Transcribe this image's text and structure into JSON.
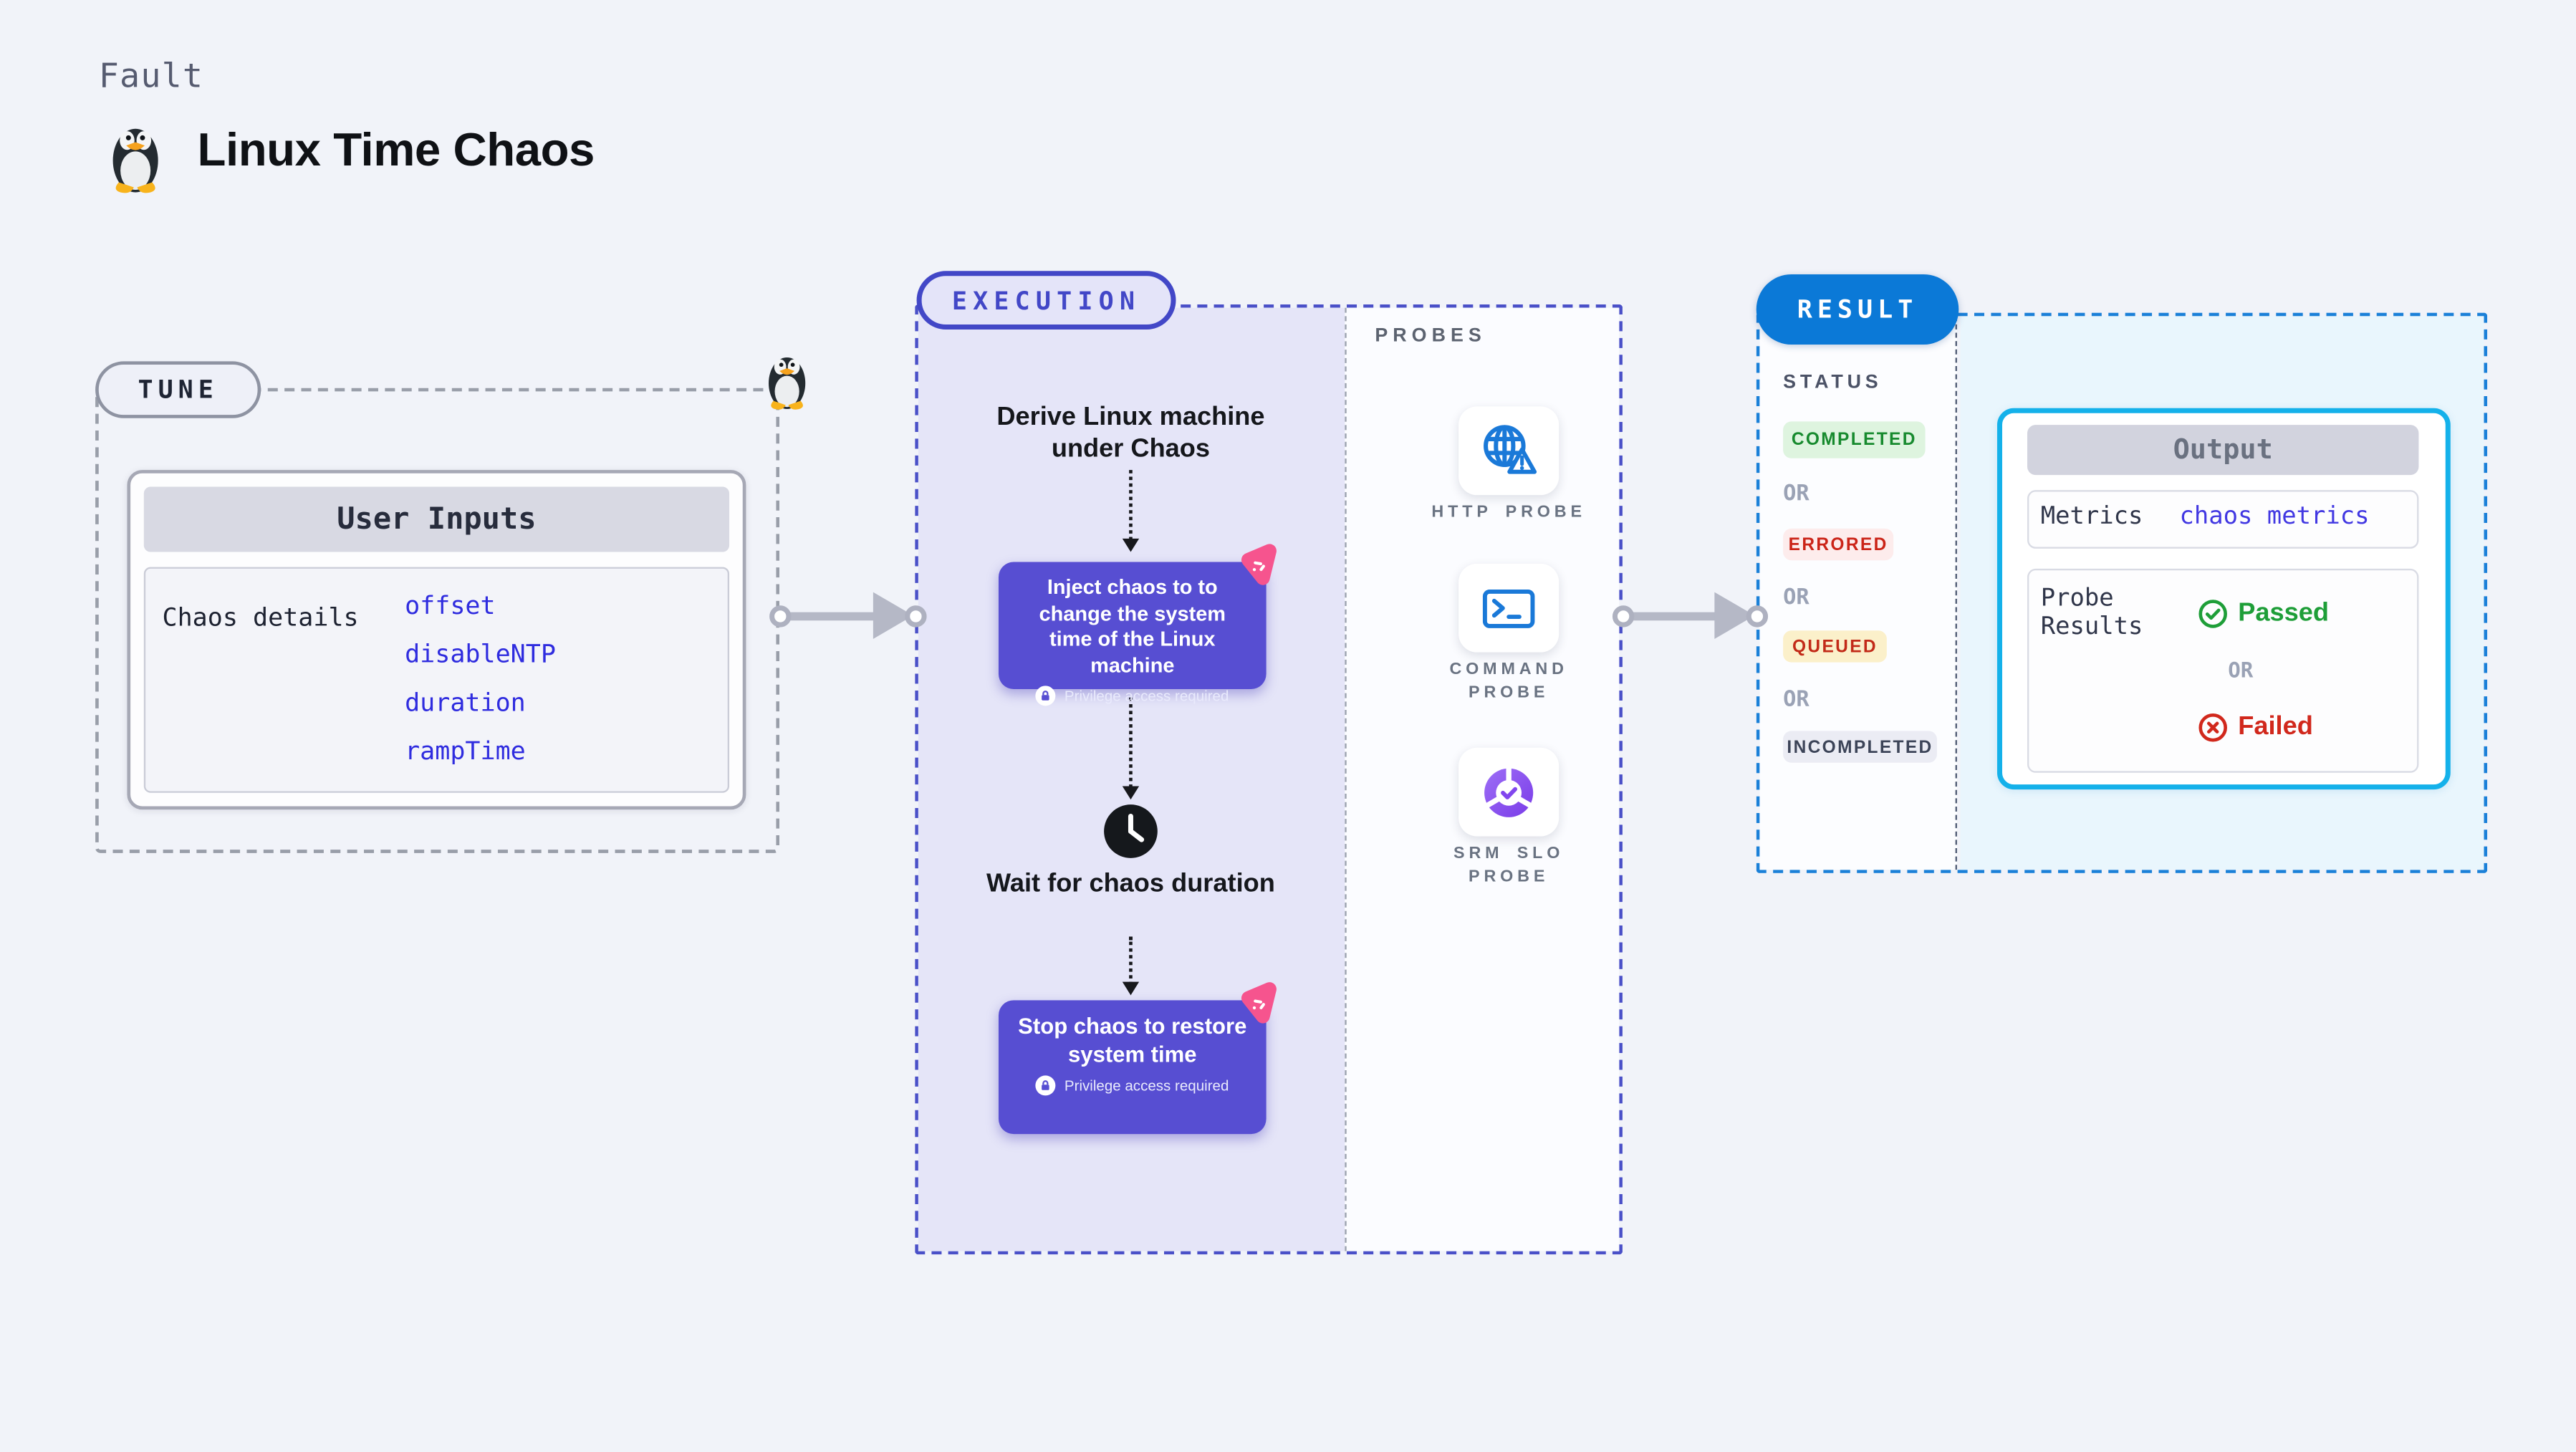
{
  "header": {
    "fault_label": "Fault",
    "title": "Linux Time Chaos"
  },
  "tune": {
    "badge": "TUNE",
    "card_title": "User Inputs",
    "row_label": "Chaos details",
    "params": [
      "offset",
      "disableNTP",
      "duration",
      "rampTime"
    ]
  },
  "execution": {
    "badge": "EXECUTION",
    "derive_text": "Derive Linux machine under Chaos",
    "inject_text": "Inject chaos to to change the system time of the Linux machine",
    "privilege_text": "Privilege access required",
    "wait_text": "Wait for chaos duration",
    "stop_text": "Stop chaos to restore system time"
  },
  "probes": {
    "label": "PROBES",
    "items": [
      {
        "name": "HTTP PROBE",
        "icon": "globe-alert-icon"
      },
      {
        "name": "COMMAND PROBE",
        "icon": "terminal-icon"
      },
      {
        "name": "SRM SLO PROBE",
        "icon": "pie-check-icon"
      }
    ]
  },
  "result": {
    "badge": "RESULT",
    "status_label": "STATUS",
    "or_label": "OR",
    "statuses": [
      {
        "label": "COMPLETED",
        "text_color": "#178a2e",
        "bg_color": "#def4df"
      },
      {
        "label": "ERRORED",
        "text_color": "#cb2418",
        "bg_color": "#fdecec"
      },
      {
        "label": "QUEUED",
        "text_color": "#c22a18",
        "bg_color": "#fbf0ca"
      },
      {
        "label": "INCOMPLETED",
        "text_color": "#3c4458",
        "bg_color": "#ebecf4"
      }
    ],
    "output": {
      "title": "Output",
      "metrics_label": "Metrics",
      "metrics_value": "chaos metrics",
      "probe_results_label": "Probe Results",
      "passed": "Passed",
      "failed": "Failed"
    }
  },
  "colors": {
    "page_bg": "#f1f3f9",
    "execution_accent": "#4247c7",
    "execution_panel_bg": "#e5e5f8",
    "chaos_box_bg": "#574ed2",
    "chaos_logo_pink": "#f6548e",
    "result_accent": "#0b79d7",
    "output_border": "#14b1ea",
    "output_panel_bg": "#e9f6fd",
    "link_blue": "#2f2cdf",
    "passed_green": "#1e9e38",
    "failed_red": "#d1281c",
    "arrow_gray": "#b5b8c6"
  }
}
